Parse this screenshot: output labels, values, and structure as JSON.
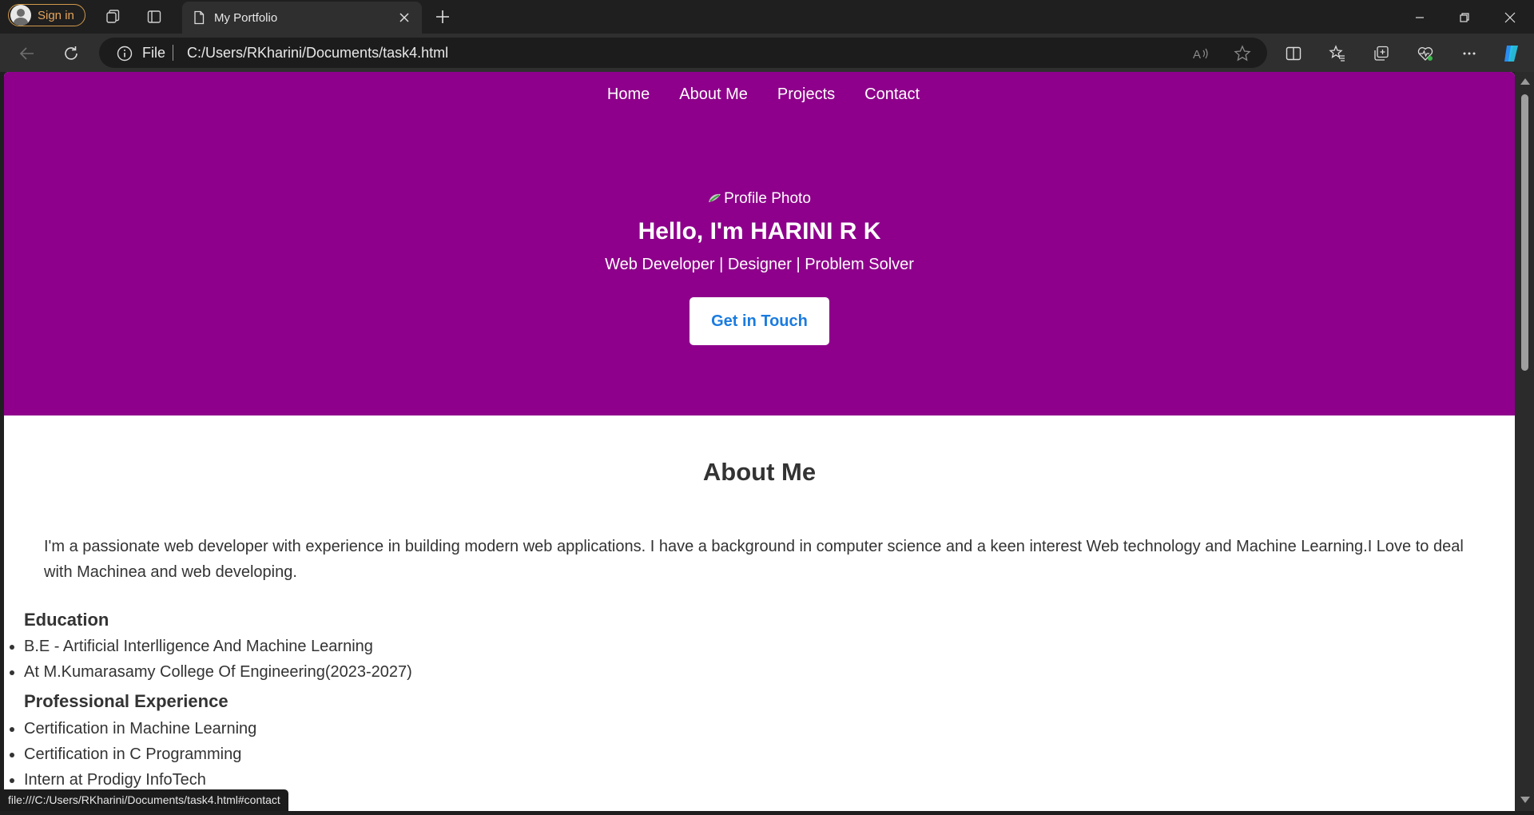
{
  "browser": {
    "signin_label": "Sign in",
    "tab_title": "My Portfolio",
    "address_scheme": "File",
    "address_url": "C:/Users/RKharini/Documents/task4.html",
    "status_url": "file:///C:/Users/RKharini/Documents/task4.html#contact"
  },
  "nav": {
    "items": [
      "Home",
      "About Me",
      "Projects",
      "Contact"
    ]
  },
  "hero": {
    "profile_alt": "Profile Photo",
    "heading": "Hello, I'm HARINI R K",
    "tagline": "Web Developer | Designer | Problem Solver",
    "cta_label": "Get in Touch",
    "bg_color": "#8e008b",
    "cta_color": "#1a7be0"
  },
  "about": {
    "title": "About Me",
    "text": "I'm a passionate web developer with experience in building modern web applications. I have a background in computer science and a keen interest Web technology and Machine Learning.I Love to deal with Machinea and web developing.",
    "education_heading": "Education",
    "education": [
      "B.E - Artificial Interlligence And Machine Learning",
      "At M.Kumarasamy College Of Engineering(2023-2027)"
    ],
    "experience_heading": "Professional Experience",
    "experience": [
      "Certification in Machine Learning",
      "Certification in C Programming",
      "Intern at Prodigy InfoTech"
    ]
  }
}
